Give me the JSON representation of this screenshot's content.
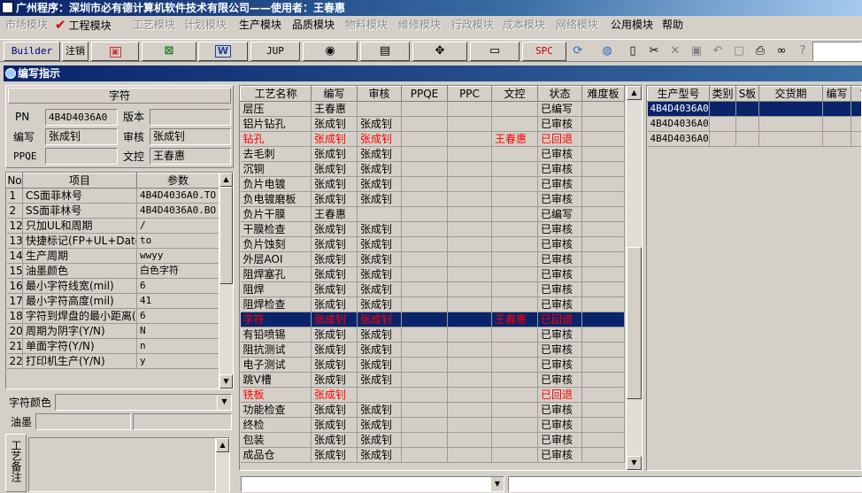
{
  "window": {
    "title": "广州程序：深圳市必有德计算机软件技术有限公司——使用者：王春惠"
  },
  "menu": [
    {
      "label": "市场模块",
      "enabled": false
    },
    {
      "label": "工程模块",
      "enabled": true,
      "checked": true
    },
    {
      "label": "工艺模块",
      "enabled": false
    },
    {
      "label": "计划模块",
      "enabled": false
    },
    {
      "label": "生产模块",
      "enabled": true
    },
    {
      "label": "品质模块",
      "enabled": true
    },
    {
      "label": "物料模块",
      "enabled": false
    },
    {
      "label": "维修模块",
      "enabled": false
    },
    {
      "label": "行政模块",
      "enabled": false
    },
    {
      "label": "成本模块",
      "enabled": false
    },
    {
      "label": "网络模块",
      "enabled": false
    },
    {
      "label": "公用模块",
      "enabled": true
    },
    {
      "label": "帮助",
      "enabled": true
    }
  ],
  "toolbar": {
    "builder": "Builder",
    "logout": "注销",
    "jup": "JUP",
    "spc": "SPC"
  },
  "panel": {
    "title": "编写指示"
  },
  "form": {
    "section": "字符",
    "pn_label": "PN",
    "pn_value": "4B4D4036A0",
    "version_label": "版本",
    "version_value": "",
    "author_label": "编写",
    "author_value": "张成钊",
    "review_label": "审核",
    "review_value": "张成钊",
    "ppqe_label": "PPQE",
    "ppqe_value": "",
    "doc_label": "文控",
    "doc_value": "王春惠"
  },
  "params": {
    "headers": [
      "No",
      "项目",
      "参数"
    ],
    "rows": [
      [
        "1",
        "CS面菲林号",
        "4B4D4036A0.TO"
      ],
      [
        "2",
        "SS面菲林号",
        "4B4D4036A0.BO"
      ],
      [
        "12",
        "只加UL和周期",
        "/"
      ],
      [
        "13",
        "快捷标记(FP+UL+DateCo",
        "to"
      ],
      [
        "14",
        "生产周期",
        "wwyy"
      ],
      [
        "15",
        "油墨颜色",
        "白色字符"
      ],
      [
        "16",
        "最小字符线宽(mil)",
        "6"
      ],
      [
        "17",
        "最小字符高度(mil)",
        "41"
      ],
      [
        "18",
        "字符到焊盘的最小距离(",
        "6"
      ],
      [
        "20",
        "周期为阴字(Y/N)",
        "N"
      ],
      [
        "21",
        "单面字符(Y/N)",
        "n"
      ],
      [
        "22",
        "打印机生产(Y/N)",
        "y"
      ]
    ]
  },
  "bottom": {
    "char_color_label": "字符颜色",
    "ink_label": "油墨",
    "remark_label": "工艺备注"
  },
  "process": {
    "headers": [
      "工艺名称",
      "编写",
      "审核",
      "PPQE",
      "PPC",
      "文控",
      "状态",
      "难度板"
    ],
    "rows": [
      {
        "cells": [
          "层压",
          "王春惠",
          "",
          "",
          "",
          "",
          "已编写",
          ""
        ],
        "style": ""
      },
      {
        "cells": [
          "铝片钻孔",
          "张成钊",
          "张成钊",
          "",
          "",
          "",
          "已审核",
          ""
        ],
        "style": ""
      },
      {
        "cells": [
          "钻孔",
          "张成钊",
          "张成钊",
          "",
          "",
          "王春惠",
          "已回退",
          ""
        ],
        "style": "red"
      },
      {
        "cells": [
          "去毛刺",
          "张成钊",
          "张成钊",
          "",
          "",
          "",
          "已审核",
          ""
        ],
        "style": ""
      },
      {
        "cells": [
          "沉铜",
          "张成钊",
          "张成钊",
          "",
          "",
          "",
          "已审核",
          ""
        ],
        "style": ""
      },
      {
        "cells": [
          "负片电镀",
          "张成钊",
          "张成钊",
          "",
          "",
          "",
          "已审核",
          ""
        ],
        "style": ""
      },
      {
        "cells": [
          "负电镀磨板",
          "张成钊",
          "张成钊",
          "",
          "",
          "",
          "已审核",
          ""
        ],
        "style": ""
      },
      {
        "cells": [
          "负片干膜",
          "王春惠",
          "",
          "",
          "",
          "",
          "已编写",
          ""
        ],
        "style": ""
      },
      {
        "cells": [
          "干膜检查",
          "张成钊",
          "张成钊",
          "",
          "",
          "",
          "已审核",
          ""
        ],
        "style": ""
      },
      {
        "cells": [
          "负片蚀刻",
          "张成钊",
          "张成钊",
          "",
          "",
          "",
          "已审核",
          ""
        ],
        "style": ""
      },
      {
        "cells": [
          "外层AOI",
          "张成钊",
          "张成钊",
          "",
          "",
          "",
          "已审核",
          ""
        ],
        "style": ""
      },
      {
        "cells": [
          "阻焊塞孔",
          "张成钊",
          "张成钊",
          "",
          "",
          "",
          "已审核",
          ""
        ],
        "style": ""
      },
      {
        "cells": [
          "阻焊",
          "张成钊",
          "张成钊",
          "",
          "",
          "",
          "已审核",
          ""
        ],
        "style": ""
      },
      {
        "cells": [
          "阻焊检查",
          "张成钊",
          "张成钊",
          "",
          "",
          "",
          "已审核",
          ""
        ],
        "style": ""
      },
      {
        "cells": [
          "字符",
          "张成钊",
          "张成钊",
          "",
          "",
          "王春惠",
          "已回退",
          ""
        ],
        "style": "sel"
      },
      {
        "cells": [
          "有铅喷锡",
          "张成钊",
          "张成钊",
          "",
          "",
          "",
          "已审核",
          ""
        ],
        "style": ""
      },
      {
        "cells": [
          "阻抗测试",
          "张成钊",
          "张成钊",
          "",
          "",
          "",
          "已审核",
          ""
        ],
        "style": ""
      },
      {
        "cells": [
          "电子测试",
          "张成钊",
          "张成钊",
          "",
          "",
          "",
          "已审核",
          ""
        ],
        "style": ""
      },
      {
        "cells": [
          "跳V槽",
          "张成钊",
          "张成钊",
          "",
          "",
          "",
          "已审核",
          ""
        ],
        "style": ""
      },
      {
        "cells": [
          "铣板",
          "张成钊",
          "",
          "",
          "",
          "",
          "已回退",
          ""
        ],
        "style": "red"
      },
      {
        "cells": [
          "功能检查",
          "张成钊",
          "张成钊",
          "",
          "",
          "",
          "已审核",
          ""
        ],
        "style": ""
      },
      {
        "cells": [
          "终检",
          "张成钊",
          "张成钊",
          "",
          "",
          "",
          "已审核",
          ""
        ],
        "style": ""
      },
      {
        "cells": [
          "包装",
          "张成钊",
          "张成钊",
          "",
          "",
          "",
          "已审核",
          ""
        ],
        "style": ""
      },
      {
        "cells": [
          "成品仓",
          "张成钊",
          "张成钊",
          "",
          "",
          "",
          "已审核",
          ""
        ],
        "style": ""
      }
    ]
  },
  "models": {
    "headers": [
      "生产型号",
      "类别",
      "S板",
      "交货期",
      "编写",
      "审"
    ],
    "rows": [
      {
        "cells": [
          "4B4D4036A0",
          "",
          "",
          "",
          "",
          ""
        ],
        "selected": true
      },
      {
        "cells": [
          "4B4D4036A0",
          "",
          "",
          "",
          "",
          ""
        ],
        "selected": false
      },
      {
        "cells": [
          "4B4D4036A0",
          "",
          "",
          "",
          "",
          ""
        ],
        "selected": false
      }
    ]
  }
}
